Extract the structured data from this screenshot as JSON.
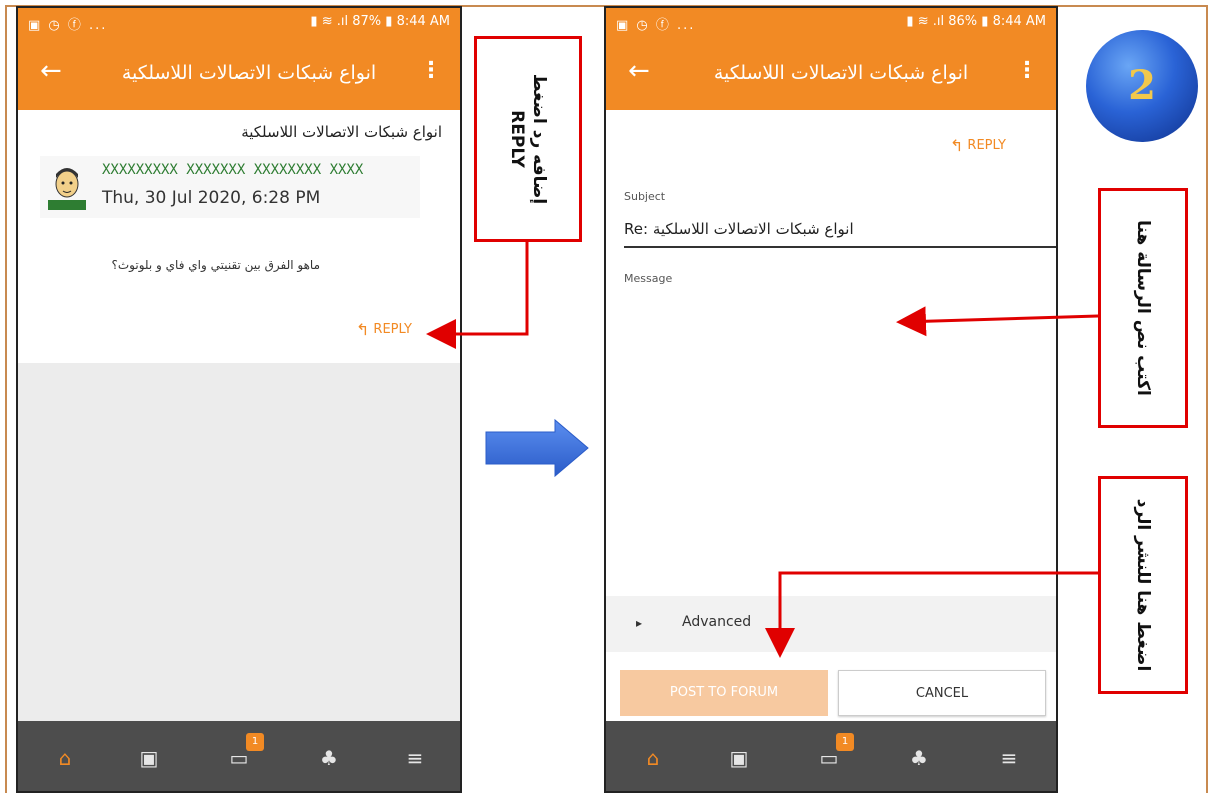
{
  "status_bar": {
    "left_icons": "▣ ◷ ⓕ ...",
    "left_screen": {
      "battery": "87%",
      "time": "8:44 AM"
    },
    "right_screen": {
      "battery": "86%",
      "time": "8:44 AM"
    }
  },
  "app_bar": {
    "title": "انواع شبكات الاتصالات اللاسلكية"
  },
  "post_view": {
    "subject": "انواع شبكات الاتصالات اللاسلكية",
    "author": "XXXXXXXXX XXXXXXX XXXXXXXX XXXX",
    "date": "Thu, 30 Jul 2020, 6:28 PM",
    "body": "ماهو الفرق بين تقنيتي واي فاي و بلوتوث؟",
    "reply_label": "REPLY"
  },
  "reply_form": {
    "reply_label": "REPLY",
    "subject_label": "Subject",
    "subject_value": "Re: انواع شبكات الاتصالات اللاسلكية",
    "message_label": "Message",
    "advanced_label": "Advanced",
    "post_button": "POST TO FORUM",
    "cancel_button": "CANCEL"
  },
  "bottom_nav": {
    "notification_count": "1"
  },
  "annotations": {
    "note1": "إضافه رد اضغط\nREPLY",
    "note2": "اكتب نص الرسالة هنا",
    "note3": "اضغط هنا للنشر الرد",
    "step_number": "2"
  },
  "colors": {
    "brand": "#f28a24",
    "annotation": "#e00000",
    "nav": "#4d4d4d"
  }
}
